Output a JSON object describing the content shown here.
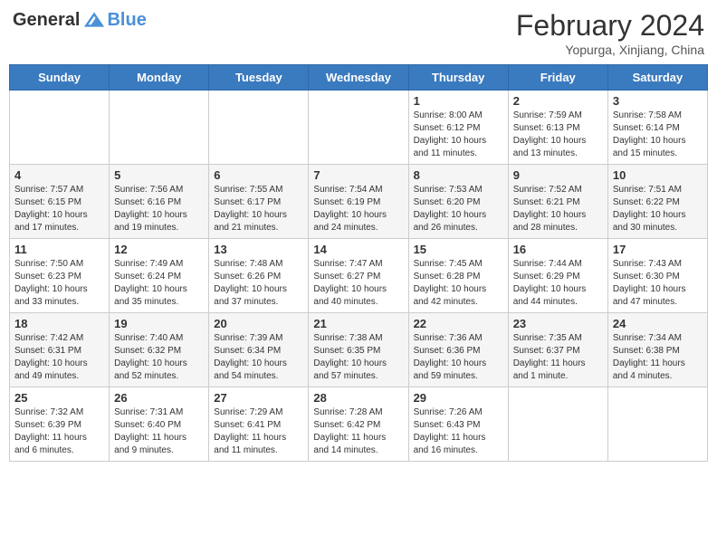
{
  "header": {
    "logo_general": "General",
    "logo_blue": "Blue",
    "month_title": "February 2024",
    "location": "Yopurga, Xinjiang, China"
  },
  "days_of_week": [
    "Sunday",
    "Monday",
    "Tuesday",
    "Wednesday",
    "Thursday",
    "Friday",
    "Saturday"
  ],
  "weeks": [
    [
      {
        "day": "",
        "info": ""
      },
      {
        "day": "",
        "info": ""
      },
      {
        "day": "",
        "info": ""
      },
      {
        "day": "",
        "info": ""
      },
      {
        "day": "1",
        "info": "Sunrise: 8:00 AM\nSunset: 6:12 PM\nDaylight: 10 hours and 11 minutes."
      },
      {
        "day": "2",
        "info": "Sunrise: 7:59 AM\nSunset: 6:13 PM\nDaylight: 10 hours and 13 minutes."
      },
      {
        "day": "3",
        "info": "Sunrise: 7:58 AM\nSunset: 6:14 PM\nDaylight: 10 hours and 15 minutes."
      }
    ],
    [
      {
        "day": "4",
        "info": "Sunrise: 7:57 AM\nSunset: 6:15 PM\nDaylight: 10 hours and 17 minutes."
      },
      {
        "day": "5",
        "info": "Sunrise: 7:56 AM\nSunset: 6:16 PM\nDaylight: 10 hours and 19 minutes."
      },
      {
        "day": "6",
        "info": "Sunrise: 7:55 AM\nSunset: 6:17 PM\nDaylight: 10 hours and 21 minutes."
      },
      {
        "day": "7",
        "info": "Sunrise: 7:54 AM\nSunset: 6:19 PM\nDaylight: 10 hours and 24 minutes."
      },
      {
        "day": "8",
        "info": "Sunrise: 7:53 AM\nSunset: 6:20 PM\nDaylight: 10 hours and 26 minutes."
      },
      {
        "day": "9",
        "info": "Sunrise: 7:52 AM\nSunset: 6:21 PM\nDaylight: 10 hours and 28 minutes."
      },
      {
        "day": "10",
        "info": "Sunrise: 7:51 AM\nSunset: 6:22 PM\nDaylight: 10 hours and 30 minutes."
      }
    ],
    [
      {
        "day": "11",
        "info": "Sunrise: 7:50 AM\nSunset: 6:23 PM\nDaylight: 10 hours and 33 minutes."
      },
      {
        "day": "12",
        "info": "Sunrise: 7:49 AM\nSunset: 6:24 PM\nDaylight: 10 hours and 35 minutes."
      },
      {
        "day": "13",
        "info": "Sunrise: 7:48 AM\nSunset: 6:26 PM\nDaylight: 10 hours and 37 minutes."
      },
      {
        "day": "14",
        "info": "Sunrise: 7:47 AM\nSunset: 6:27 PM\nDaylight: 10 hours and 40 minutes."
      },
      {
        "day": "15",
        "info": "Sunrise: 7:45 AM\nSunset: 6:28 PM\nDaylight: 10 hours and 42 minutes."
      },
      {
        "day": "16",
        "info": "Sunrise: 7:44 AM\nSunset: 6:29 PM\nDaylight: 10 hours and 44 minutes."
      },
      {
        "day": "17",
        "info": "Sunrise: 7:43 AM\nSunset: 6:30 PM\nDaylight: 10 hours and 47 minutes."
      }
    ],
    [
      {
        "day": "18",
        "info": "Sunrise: 7:42 AM\nSunset: 6:31 PM\nDaylight: 10 hours and 49 minutes."
      },
      {
        "day": "19",
        "info": "Sunrise: 7:40 AM\nSunset: 6:32 PM\nDaylight: 10 hours and 52 minutes."
      },
      {
        "day": "20",
        "info": "Sunrise: 7:39 AM\nSunset: 6:34 PM\nDaylight: 10 hours and 54 minutes."
      },
      {
        "day": "21",
        "info": "Sunrise: 7:38 AM\nSunset: 6:35 PM\nDaylight: 10 hours and 57 minutes."
      },
      {
        "day": "22",
        "info": "Sunrise: 7:36 AM\nSunset: 6:36 PM\nDaylight: 10 hours and 59 minutes."
      },
      {
        "day": "23",
        "info": "Sunrise: 7:35 AM\nSunset: 6:37 PM\nDaylight: 11 hours and 1 minute."
      },
      {
        "day": "24",
        "info": "Sunrise: 7:34 AM\nSunset: 6:38 PM\nDaylight: 11 hours and 4 minutes."
      }
    ],
    [
      {
        "day": "25",
        "info": "Sunrise: 7:32 AM\nSunset: 6:39 PM\nDaylight: 11 hours and 6 minutes."
      },
      {
        "day": "26",
        "info": "Sunrise: 7:31 AM\nSunset: 6:40 PM\nDaylight: 11 hours and 9 minutes."
      },
      {
        "day": "27",
        "info": "Sunrise: 7:29 AM\nSunset: 6:41 PM\nDaylight: 11 hours and 11 minutes."
      },
      {
        "day": "28",
        "info": "Sunrise: 7:28 AM\nSunset: 6:42 PM\nDaylight: 11 hours and 14 minutes."
      },
      {
        "day": "29",
        "info": "Sunrise: 7:26 AM\nSunset: 6:43 PM\nDaylight: 11 hours and 16 minutes."
      },
      {
        "day": "",
        "info": ""
      },
      {
        "day": "",
        "info": ""
      }
    ]
  ]
}
